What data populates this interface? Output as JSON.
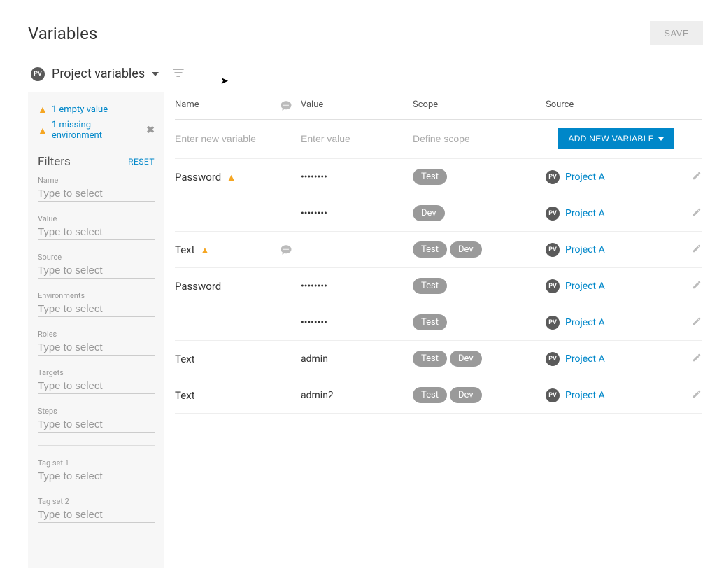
{
  "page": {
    "title": "Variables",
    "save_label": "SAVE"
  },
  "scope_selector": {
    "badge": "PV",
    "label": "Project variables"
  },
  "warnings": [
    {
      "text": "1 empty value",
      "dismissable": false
    },
    {
      "text": "1 missing environment",
      "dismissable": true
    }
  ],
  "filters": {
    "heading": "Filters",
    "reset": "RESET",
    "groups": [
      {
        "label": "Name",
        "placeholder": "Type to select"
      },
      {
        "label": "Value",
        "placeholder": "Type to select"
      },
      {
        "label": "Source",
        "placeholder": "Type to select"
      },
      {
        "label": "Environments",
        "placeholder": "Type to select"
      },
      {
        "label": "Roles",
        "placeholder": "Type to select"
      },
      {
        "label": "Targets",
        "placeholder": "Type to select"
      },
      {
        "label": "Steps",
        "placeholder": "Type to select"
      }
    ],
    "tag_groups": [
      {
        "label": "Tag set 1",
        "placeholder": "Type to select"
      },
      {
        "label": "Tag set 2",
        "placeholder": "Type to select"
      }
    ]
  },
  "table": {
    "headers": {
      "name": "Name",
      "value": "Value",
      "scope": "Scope",
      "source": "Source"
    },
    "new_row": {
      "name_placeholder": "Enter new variable",
      "value_placeholder": "Enter value",
      "scope_placeholder": "Define scope",
      "button": "ADD NEW VARIABLE"
    },
    "rows": [
      {
        "name": "Password",
        "warn": true,
        "comment": false,
        "value": "••••••••",
        "scopes": [
          "Test"
        ],
        "source_badge": "PV",
        "source": "Project A"
      },
      {
        "name": "",
        "warn": false,
        "comment": false,
        "value": "••••••••",
        "scopes": [
          "Dev"
        ],
        "source_badge": "PV",
        "source": "Project A"
      },
      {
        "name": "Text",
        "warn": true,
        "comment": true,
        "value": "",
        "scopes": [
          "Test",
          "Dev"
        ],
        "source_badge": "PV",
        "source": "Project A"
      },
      {
        "name": "Password",
        "warn": false,
        "comment": false,
        "value": "••••••••",
        "scopes": [
          "Test"
        ],
        "source_badge": "PV",
        "source": "Project A"
      },
      {
        "name": "",
        "warn": false,
        "comment": false,
        "value": "••••••••",
        "scopes": [
          "Test"
        ],
        "source_badge": "PV",
        "source": "Project A"
      },
      {
        "name": "Text",
        "warn": false,
        "comment": false,
        "value": "admin",
        "scopes": [
          "Test",
          "Dev"
        ],
        "source_badge": "PV",
        "source": "Project A"
      },
      {
        "name": "Text",
        "warn": false,
        "comment": false,
        "value": "admin2",
        "scopes": [
          "Test",
          "Dev"
        ],
        "source_badge": "PV",
        "source": "Project A"
      }
    ]
  }
}
